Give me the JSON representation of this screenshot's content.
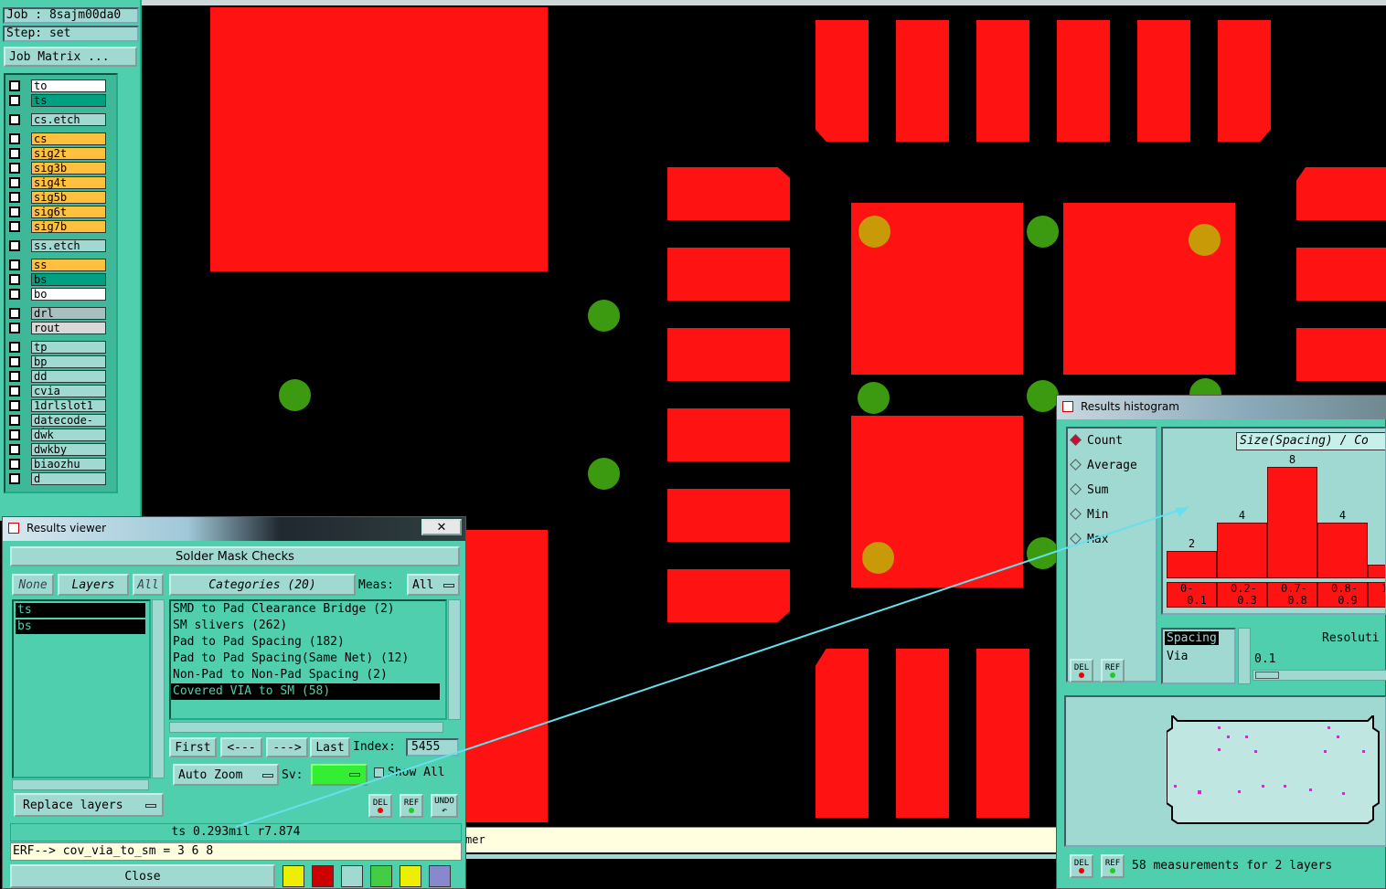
{
  "job_panel": {
    "job": "Job : 8sajm00da0",
    "step": "Step: set",
    "job_matrix_button": "Job Matrix ..."
  },
  "layers": [
    {
      "name": "to",
      "color": "#ffffff"
    },
    {
      "name": "ts",
      "color": "#00a080"
    },
    {
      "name": "cs.etch",
      "color": "#9fd9d2"
    },
    {
      "name": "cs",
      "color": "#ffc040"
    },
    {
      "name": "sig2t",
      "color": "#ffc040"
    },
    {
      "name": "sig3b",
      "color": "#ffc040"
    },
    {
      "name": "sig4t",
      "color": "#ffc040"
    },
    {
      "name": "sig5b",
      "color": "#ffc040"
    },
    {
      "name": "sig6t",
      "color": "#ffc040"
    },
    {
      "name": "sig7b",
      "color": "#ffc040"
    },
    {
      "name": "ss.etch",
      "color": "#9fd9d2"
    },
    {
      "name": "ss",
      "color": "#ffc040"
    },
    {
      "name": "bs",
      "color": "#00a080"
    },
    {
      "name": "bo",
      "color": "#ffffff"
    },
    {
      "name": "drl",
      "color": "#a8c0c0"
    },
    {
      "name": "rout",
      "color": "#d8d8d8"
    },
    {
      "name": "tp",
      "color": "#9fd9d2"
    },
    {
      "name": "bp",
      "color": "#9fd9d2"
    },
    {
      "name": "dd",
      "color": "#9fd9d2"
    },
    {
      "name": "cvia",
      "color": "#9fd9d2"
    },
    {
      "name": "1drlslot1",
      "color": "#9fd9d2"
    },
    {
      "name": "datecode-pt",
      "color": "#9fd9d2"
    },
    {
      "name": "dwk",
      "color": "#9fd9d2"
    },
    {
      "name": "dwkby",
      "color": "#9fd9d2"
    },
    {
      "name": "biaozhu",
      "color": "#9fd9d2"
    },
    {
      "name": "d",
      "color": "#9fd9d2"
    }
  ],
  "results_viewer": {
    "title": "Results viewer",
    "close_x": "✕",
    "header": "Solder Mask Checks",
    "none_btn": "None",
    "layers_btn": "Layers",
    "all_btn": "All",
    "categories_btn": "Categories (20)",
    "meas_label": "Meas:",
    "meas_value": "All",
    "layer_list": [
      "ts",
      "bs"
    ],
    "categories": [
      "SMD to Pad Clearance Bridge (2)",
      "SM slivers (262)",
      "Pad to Pad Spacing (182)",
      "Pad to Pad Spacing(Same Net) (12)",
      "Non-Pad to Non-Pad Spacing (2)",
      "Covered VIA to SM (58)"
    ],
    "first_btn": "First",
    "prev_btn": "<---",
    "next_btn": "--->",
    "last_btn": "Last",
    "index_label": "Index:",
    "index_value": "5455",
    "auto_zoom": "Auto Zoom",
    "sv_label": "Sv:",
    "show_all": "Show All",
    "replace_layers": "Replace layers",
    "del": "DEL",
    "ref": "REF",
    "undo": "UNDO",
    "status": "ts 0.293mil  r7.874",
    "erf_line": "ERF--> cov_via_to_sm = 3 6 8",
    "close_btn": "Close"
  },
  "histogram": {
    "title": "Results histogram",
    "options": [
      "Count",
      "Average",
      "Sum",
      "Min",
      "Max"
    ],
    "chart_title": "Size(Spacing) / Co",
    "list_header": "Spacing",
    "list_item": "Via",
    "resolution_label": "Resoluti",
    "resolution_value": "0.1",
    "del": "DEL",
    "ref": "REF",
    "summary": "58 measurements for 2 layers"
  },
  "chart_data": {
    "type": "bar",
    "title": "Size(Spacing) / Co",
    "categories": [
      "0-0.1",
      "0.2-0.3",
      "0.7-0.8",
      "0.8-0.9",
      "1"
    ],
    "values": [
      2,
      4,
      8,
      4,
      1
    ],
    "bar_labels": [
      "2",
      "4",
      "8",
      "4",
      ""
    ],
    "tick_labels": [
      [
        "0-",
        "0.1"
      ],
      [
        "0.2-",
        "0.3"
      ],
      [
        "0.7-",
        "0.8"
      ],
      [
        "0.8-",
        "0.9"
      ],
      [
        "1",
        ""
      ]
    ]
  },
  "message_bar": "mer",
  "colors": {
    "pad": "#ff1212",
    "via": "#3b9a10",
    "panel": "#4fcfae",
    "panel_light": "#9fd9d2"
  }
}
